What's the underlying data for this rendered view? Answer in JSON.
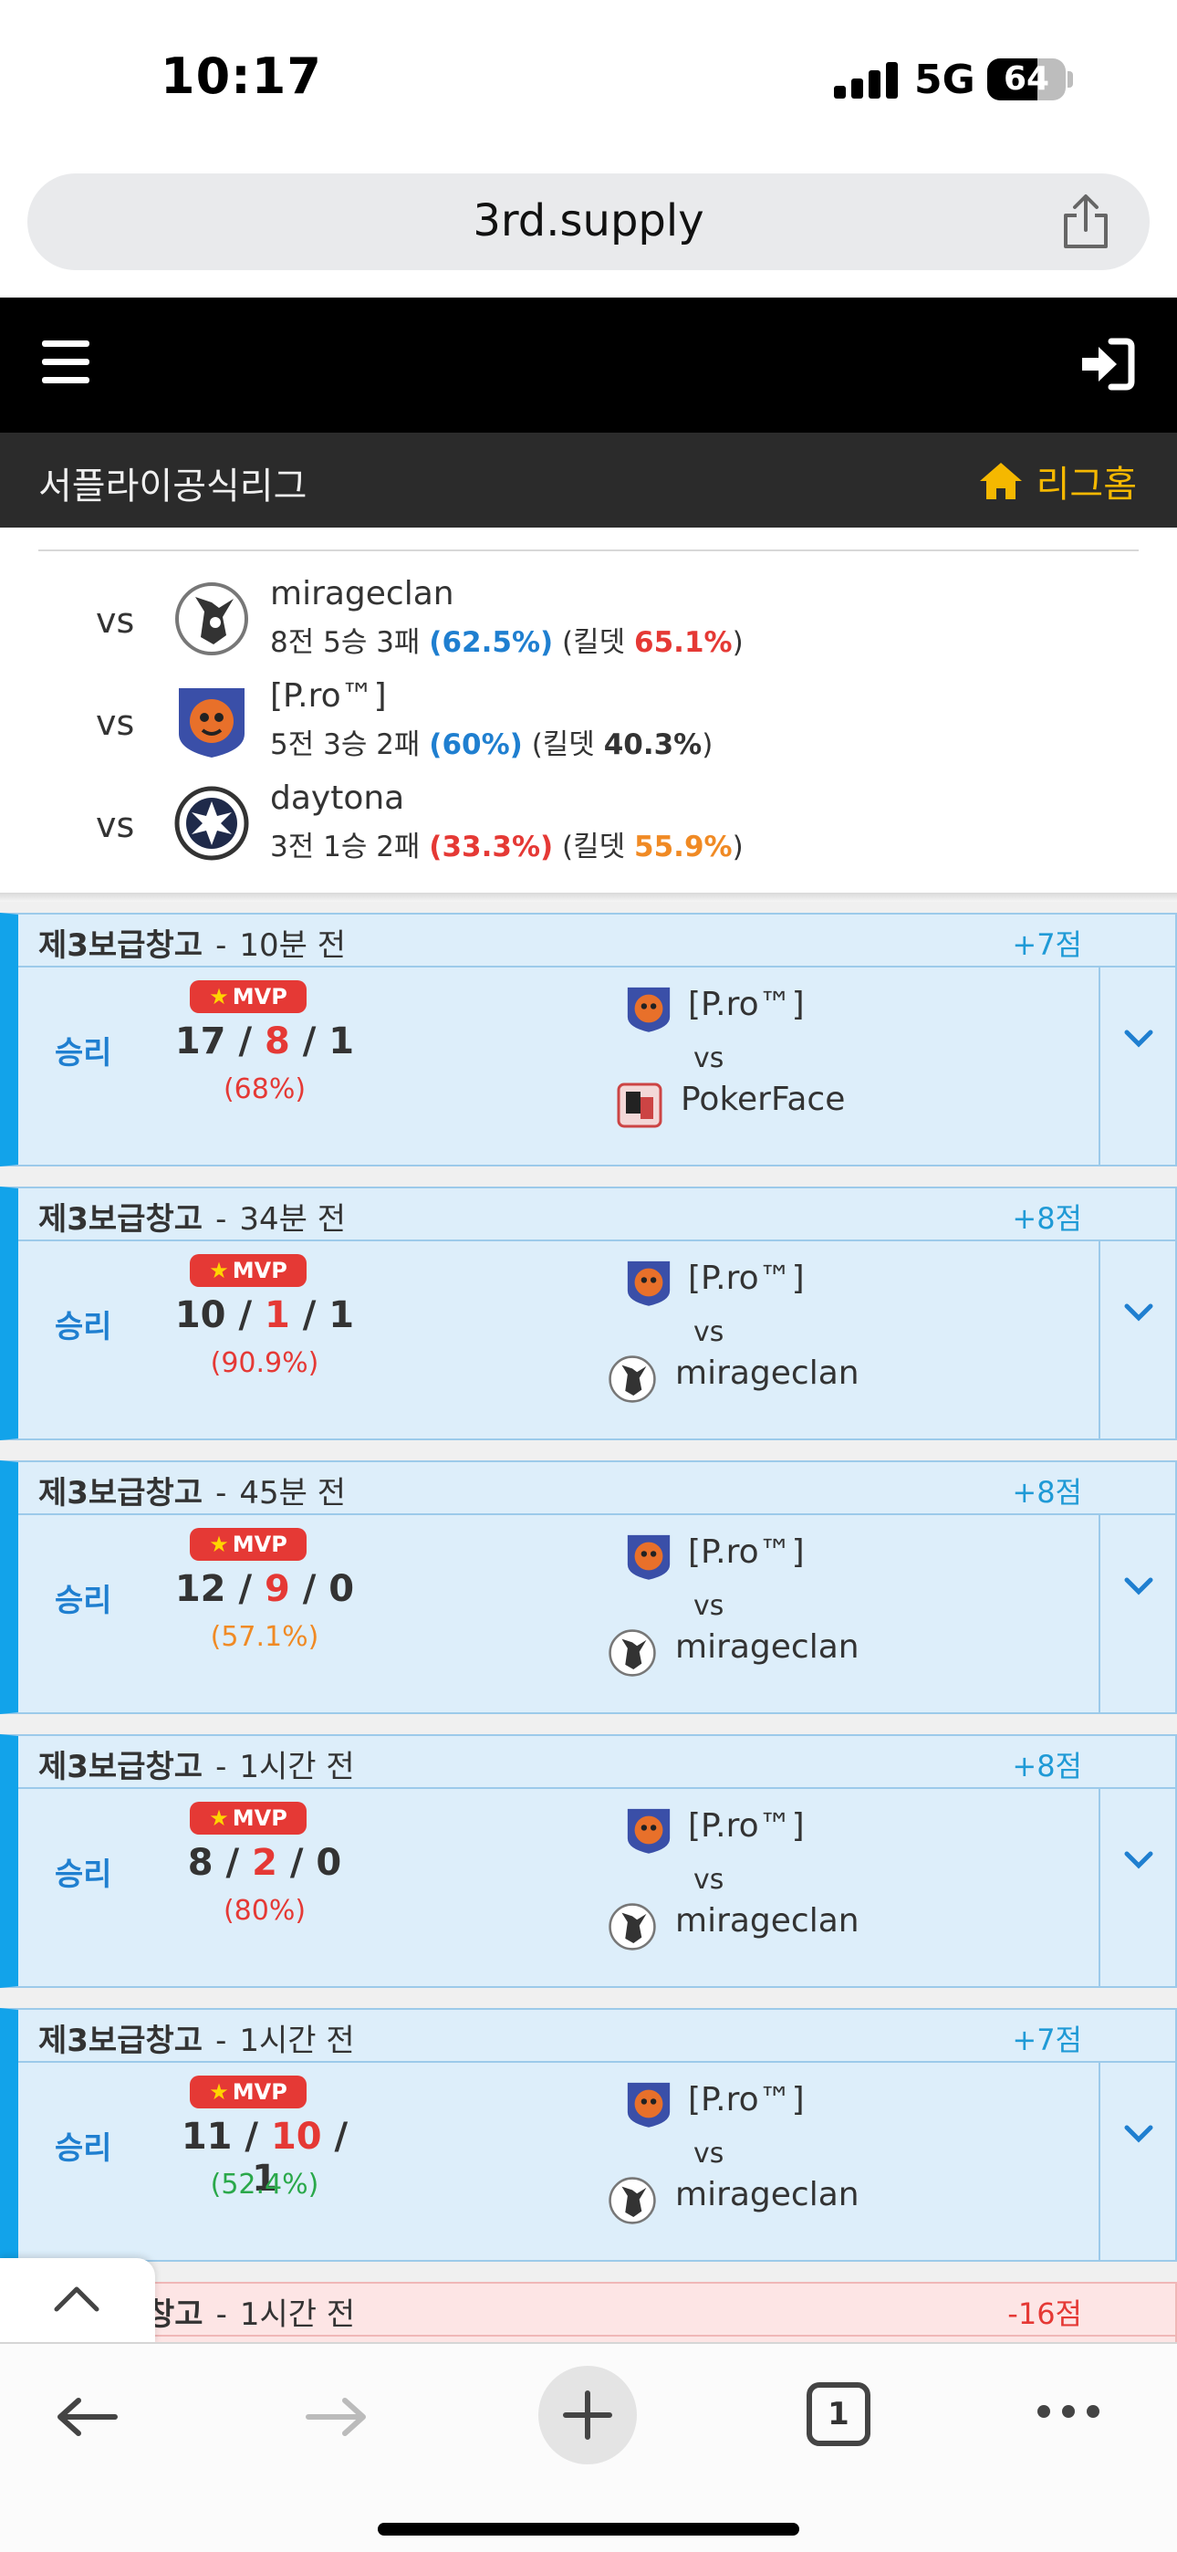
{
  "status": {
    "time": "10:17",
    "network": "5G",
    "battery": "64",
    "battery_level": 0.64
  },
  "browser": {
    "url": "3rd.supply",
    "tab_count": "1"
  },
  "league": {
    "title": "서플라이공식리그",
    "home_label": "리그홈"
  },
  "vs_label": "vs",
  "opponents": [
    {
      "name": "mirageclan",
      "rec_prefix": "8전 5승 3패 ",
      "winrate": "(62.5%)",
      "kd_label": " (킬뎃 ",
      "kd": "65.1%",
      "kd_close": ")",
      "winrate_color": "blue",
      "kd_color": "red",
      "logo": "mirage-logo"
    },
    {
      "name": " [P.ro™]",
      "rec_prefix": "5전 3승 2패 ",
      "winrate": "(60%)",
      "kd_label": " (킬뎃 ",
      "kd": "40.3%",
      "kd_close": ")",
      "winrate_color": "blue",
      "kd_color": "dark",
      "logo": "pro-logo"
    },
    {
      "name": "daytona",
      "rec_prefix": "3전 1승 2패 ",
      "winrate": "(33.3%)",
      "kd_label": " (킬뎃 ",
      "kd": "55.9%",
      "kd_close": ")",
      "winrate_color": "red",
      "kd_color": "orange",
      "logo": "daytona-logo"
    }
  ],
  "matches": [
    {
      "map": "제3보급창고",
      "sep": "-",
      "time": "10분 전",
      "points": "+7점",
      "result": "승리",
      "mvp": "MVP",
      "k": "17",
      "d": "8",
      "a": "1",
      "ratio": "(68%)",
      "ratio_color": "red",
      "team1": "[P.ro™]",
      "vs": "vs",
      "team2": "PokerFace",
      "team2_logo": "pokerface-logo"
    },
    {
      "map": "제3보급창고",
      "sep": "-",
      "time": "34분 전",
      "points": "+8점",
      "result": "승리",
      "mvp": "MVP",
      "k": "10",
      "d": "1",
      "a": "1",
      "ratio": "(90.9%)",
      "ratio_color": "red",
      "team1": "[P.ro™]",
      "vs": "vs",
      "team2": "mirageclan",
      "team2_logo": "mirage-logo"
    },
    {
      "map": "제3보급창고",
      "sep": "-",
      "time": "45분 전",
      "points": "+8점",
      "result": "승리",
      "mvp": "MVP",
      "k": "12",
      "d": "9",
      "a": "0",
      "ratio": "(57.1%)",
      "ratio_color": "orange",
      "team1": "[P.ro™]",
      "vs": "vs",
      "team2": "mirageclan",
      "team2_logo": "mirage-logo"
    },
    {
      "map": "제3보급창고",
      "sep": "-",
      "time": "1시간 전",
      "points": "+8점",
      "result": "승리",
      "mvp": "MVP",
      "k": "8",
      "d": "2",
      "a": "0",
      "ratio": "(80%)",
      "ratio_color": "red",
      "team1": "[P.ro™]",
      "vs": "vs",
      "team2": "mirageclan",
      "team2_logo": "mirage-logo"
    },
    {
      "map": "제3보급창고",
      "sep": "-",
      "time": "1시간 전",
      "points": "+7점",
      "result": "승리",
      "mvp": "MVP",
      "k": "11",
      "d": "10",
      "a": "1",
      "ratio": "(52.4%)",
      "ratio_color": "green",
      "team1": "[P.ro™]",
      "vs": "vs",
      "team2": "mirageclan",
      "team2_logo": "mirage-logo"
    }
  ],
  "partial_match": {
    "map_fragment": "창고",
    "sep": "-",
    "time": "1시간 전",
    "points": "-16점"
  },
  "colors": {
    "win_accent": "#12a3ea",
    "loss_accent": "#e45757",
    "gold": "#f5b800",
    "mvp_red": "#e53935"
  }
}
